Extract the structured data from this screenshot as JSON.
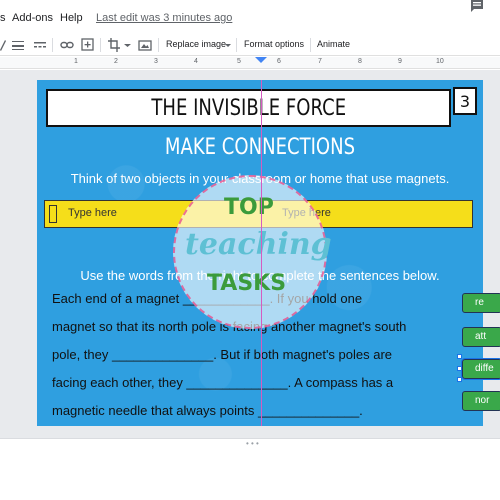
{
  "menu": {
    "items": [
      "s",
      "Add-ons",
      "Help"
    ],
    "last_edit": "Last edit was 3 minutes ago"
  },
  "toolbar": {
    "replace_image": "Replace image",
    "format_options": "Format options",
    "animate": "Animate"
  },
  "ruler": {
    "numbers": [
      "1",
      "2",
      "3",
      "4",
      "5",
      "6",
      "7",
      "8",
      "9",
      "10"
    ]
  },
  "slide": {
    "title": "THE INVISIBLE FORCE",
    "page_number": "3",
    "subtitle": "MAKE CONNECTIONS",
    "instruction_1": "Think of two objects in your classroom or home that use magnets.",
    "input_left": "Type here",
    "input_right": "Type here",
    "instruction_2": "Use the words from the right to complete the sentences below.",
    "sentences": [
      "Each end of a magnet ____________. If you hold one",
      "magnet so that its north pole is facing another magnet's south",
      "pole, they ______________. But if both magnet's poles are",
      "facing each other, they ______________. A compass has a",
      "magnetic needle that always points ______________."
    ],
    "word_chips": [
      "re",
      "att",
      "diffe",
      "nor"
    ]
  },
  "watermark": {
    "line1": "TOP",
    "line2": "teaching",
    "line3": "TASKS"
  },
  "colors": {
    "slide_bg": "#2f9fe0",
    "yellow_band": "#f5de1a",
    "chip_green": "#3aa84a",
    "guide_pink": "#d55cc0",
    "selection_blue": "#1a73e8"
  }
}
